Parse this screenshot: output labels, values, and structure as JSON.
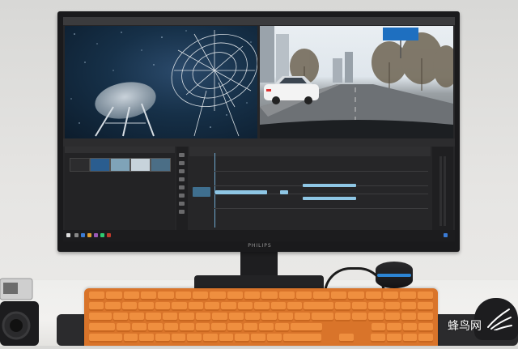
{
  "monitor": {
    "brand_label": "PHILIPS"
  },
  "watermark": {
    "text": "蜂鸟网"
  },
  "colors": {
    "screen_accent": "#8ec6e4",
    "keyboard_orange": "#ef8f3f",
    "speaker_light": "#2e90e8",
    "road_sign_blue": "#1e6fc0"
  }
}
